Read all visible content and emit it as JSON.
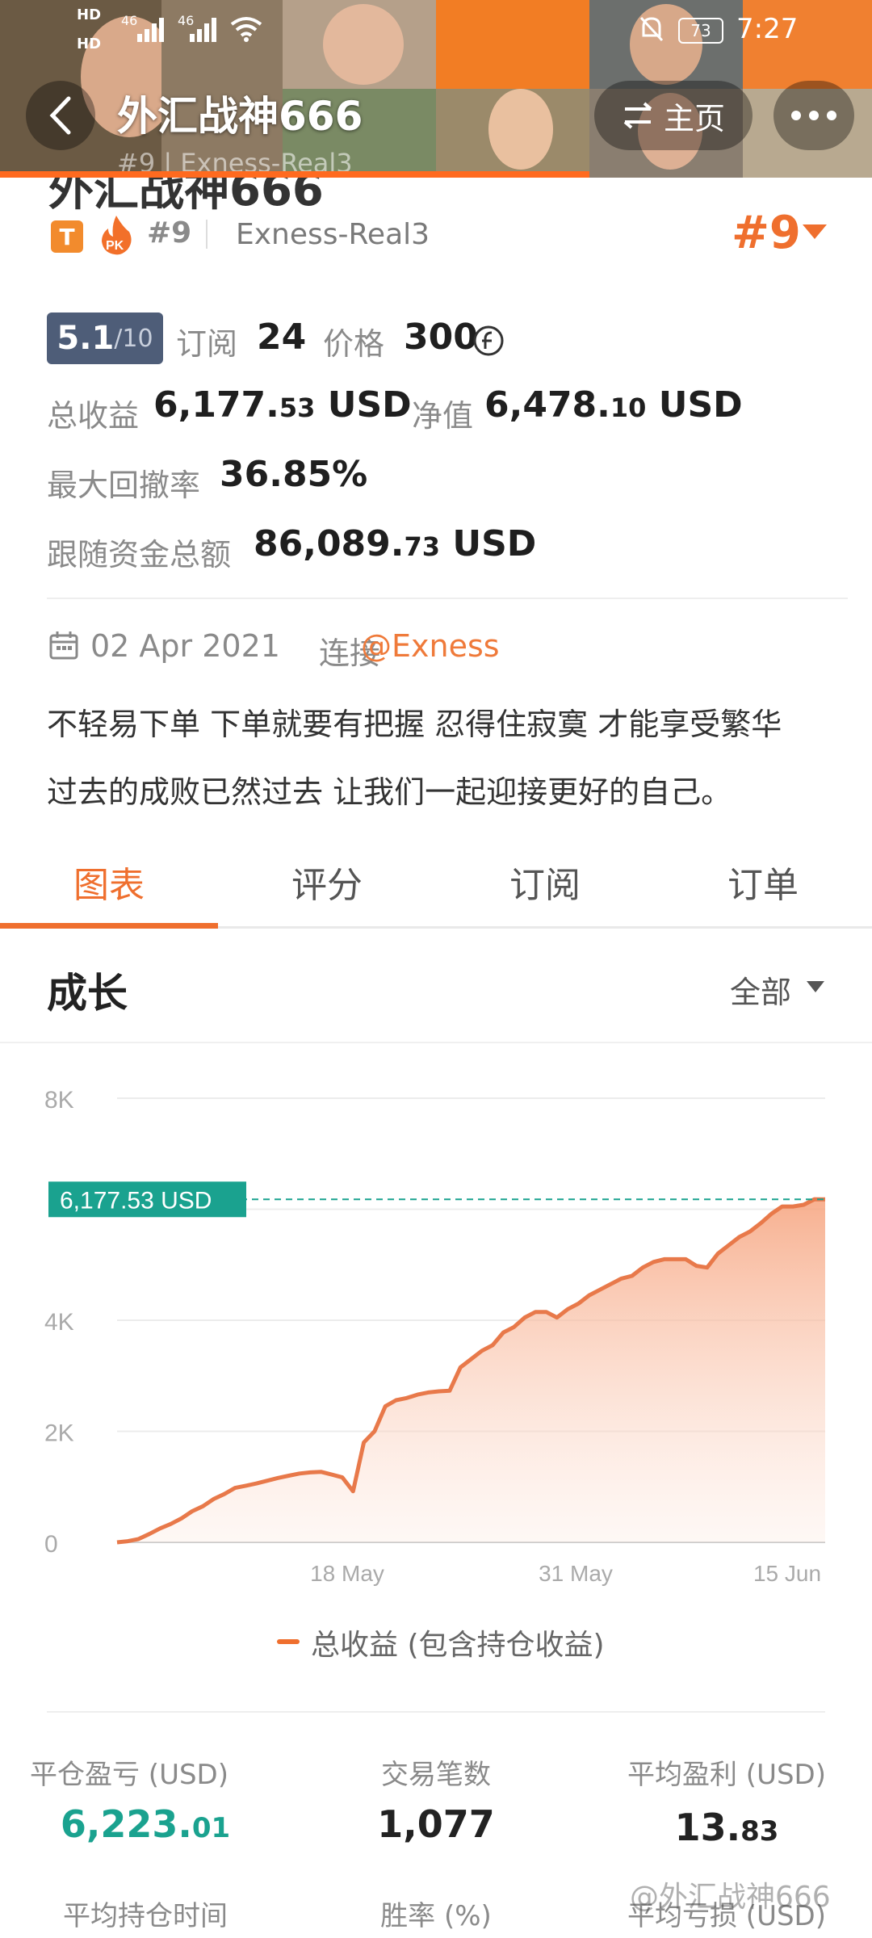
{
  "status": {
    "hd1": "HD",
    "hd2": "HD",
    "signal1": "46",
    "signal2": "46",
    "battery": "73",
    "time": "7:27"
  },
  "header": {
    "title": "外汇战神666",
    "home_label": "主页",
    "ghost_sub": "#9 | Exness-Real3",
    "ghost_title": "外汇战神666"
  },
  "profile": {
    "badge": "T",
    "pk": "PK",
    "rank": "#9",
    "server": "Exness-Real3",
    "rank_big": "#9",
    "score": "5.1",
    "score_max": "/10",
    "subscribe_label": "订阅",
    "subscribe_count": "24",
    "price_label": "价格",
    "price_value": "300",
    "total_profit_label": "总收益",
    "total_profit_int": "6,177.",
    "total_profit_dec": "53",
    "total_profit_unit": "USD",
    "equity_label": "净值",
    "equity_int": "6,478.",
    "equity_dec": "10",
    "equity_unit": "USD",
    "drawdown_label": "最大回撤率",
    "drawdown_value": "36.85%",
    "follow_label": "跟随资金总额",
    "follow_int": "86,089.",
    "follow_dec": "73",
    "follow_unit": "USD",
    "connect_date": "02 Apr 2021",
    "connect_label": "连接",
    "broker_link": "@Exness",
    "bio_line1": "不轻易下单 下单就要有把握 忍得住寂寞 才能享受繁华",
    "bio_line2": "过去的成败已然过去 让我们一起迎接更好的自己。"
  },
  "tabs": [
    "图表",
    "评分",
    "订阅",
    "订单"
  ],
  "growth": {
    "title": "成长",
    "filter": "全部"
  },
  "chart_data": {
    "type": "area",
    "y_ticks": [
      "8K",
      "4K",
      "2K",
      "0"
    ],
    "x_ticks": [
      "18 May",
      "31 May",
      "15 Jun"
    ],
    "ylim": [
      0,
      8000
    ],
    "current_label": "6,177.53 USD",
    "current_value": 6177.53,
    "legend": "总收益 (包含持仓收益)",
    "series": [
      {
        "name": "总收益 (包含持仓收益)",
        "values": [
          0,
          20,
          60,
          150,
          250,
          330,
          430,
          560,
          650,
          780,
          870,
          980,
          1020,
          1060,
          1110,
          1160,
          1200,
          1240,
          1260,
          1270,
          1220,
          1170,
          920,
          1800,
          2000,
          2450,
          2560,
          2600,
          2660,
          2700,
          2720,
          2730,
          3150,
          3300,
          3450,
          3550,
          3780,
          3880,
          4050,
          4150,
          4150,
          4050,
          4200,
          4300,
          4450,
          4550,
          4650,
          4750,
          4800,
          4950,
          5050,
          5100,
          5100,
          5100,
          4980,
          4950,
          5200,
          5350,
          5500,
          5600,
          5750,
          5920,
          6050,
          6050,
          6080,
          6180,
          6177.53
        ]
      }
    ],
    "color": "#e8794a"
  },
  "stats": {
    "close_pl_label": "平仓盈亏 (USD)",
    "close_pl_int": "6,223.",
    "close_pl_dec": "01",
    "trades_label": "交易笔数",
    "trades_value": "1,077",
    "avg_profit_label": "平均盈利 (USD)",
    "avg_profit_int": "13.",
    "avg_profit_dec": "83",
    "avg_hold_label": "平均持仓时间",
    "winrate_label": "胜率 (%)",
    "avg_loss_label": "平均亏损 (USD)"
  },
  "watermark": "@外汇战神666"
}
